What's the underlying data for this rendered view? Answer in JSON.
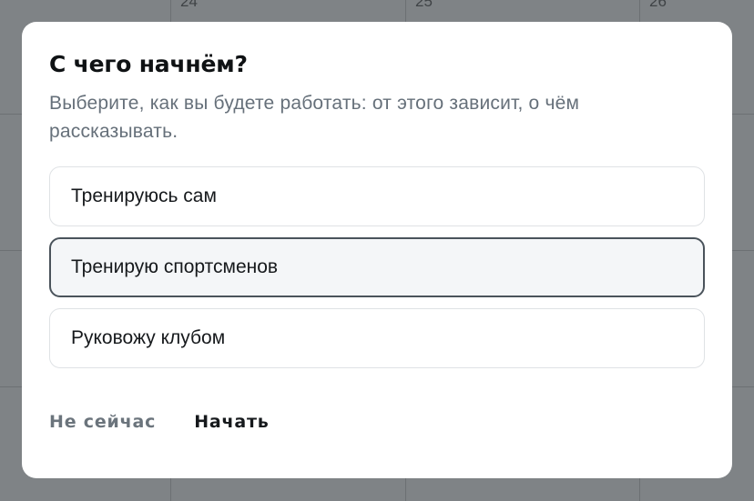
{
  "calendar": {
    "visible_day_numbers": [
      "24",
      "25",
      "26"
    ]
  },
  "dialog": {
    "title": "С чего начнём?",
    "subtitle": "Выберите, как вы будете работать: от этого зависит, о чём рассказывать.",
    "options": [
      {
        "label": "Тренируюсь сам",
        "selected": false
      },
      {
        "label": "Тренирую спортсменов",
        "selected": true
      },
      {
        "label": "Руковожу клубом",
        "selected": false
      }
    ],
    "actions": {
      "secondary_label": "Не сейчас",
      "primary_label": "Начать"
    }
  },
  "colors": {
    "overlay": "#7f8386",
    "selected_border": "#4a535b",
    "muted_text": "#66707a"
  }
}
